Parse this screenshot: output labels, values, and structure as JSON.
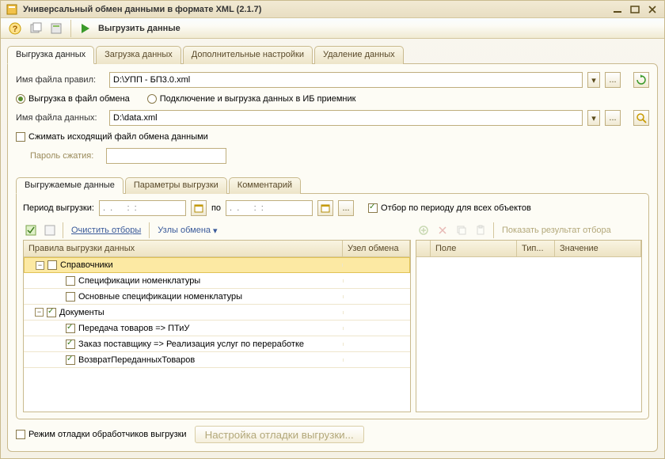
{
  "window": {
    "title": "Универсальный обмен данными в формате XML (2.1.7)"
  },
  "toolbar": {
    "run_label": "Выгрузить данные"
  },
  "tabs": [
    {
      "label": "Выгрузка данных",
      "active": true
    },
    {
      "label": "Загрузка данных",
      "active": false
    },
    {
      "label": "Дополнительные настройки",
      "active": false
    },
    {
      "label": "Удаление данных",
      "active": false
    }
  ],
  "upload": {
    "rules_file_label": "Имя файла правил:",
    "rules_file_value": "D:\\УПП - БП3.0.xml",
    "radio_export_file": "Выгрузка в файл обмена",
    "radio_export_connect": "Подключение и выгрузка данных в ИБ приемник",
    "data_file_label": "Имя файла данных:",
    "data_file_value": "D:\\data.xml",
    "compress_label": "Сжимать исходящий файл обмена данными",
    "compress_pwd_label": "Пароль сжатия:"
  },
  "inner_tabs": [
    {
      "label": "Выгружаемые данные",
      "active": true
    },
    {
      "label": "Параметры выгрузки",
      "active": false
    },
    {
      "label": "Комментарий",
      "active": false
    }
  ],
  "period": {
    "label": "Период выгрузки:",
    "from_placeholder": ".  .      :  :",
    "to_label": "по",
    "to_placeholder": ".  .      :  :",
    "filter_all_label": "Отбор по периоду для всех объектов"
  },
  "gridbar": {
    "clear_filters": "Очистить отборы",
    "nodes": "Узлы обмена",
    "show_result": "Показать результат отбора"
  },
  "left_grid": {
    "col_rules": "Правила выгрузки данных",
    "col_node": "Узел обмена",
    "rows": [
      {
        "level": 0,
        "expander": "-",
        "checked": false,
        "label": "Справочники",
        "selected": true
      },
      {
        "level": 1,
        "expander": "",
        "checked": false,
        "label": "Спецификации номенклатуры"
      },
      {
        "level": 1,
        "expander": "",
        "checked": false,
        "label": "Основные спецификации номенклатуры"
      },
      {
        "level": 0,
        "expander": "-",
        "checked": true,
        "label": "Документы"
      },
      {
        "level": 1,
        "expander": "",
        "checked": true,
        "label": "Передача товаров => ПТиУ"
      },
      {
        "level": 1,
        "expander": "",
        "checked": true,
        "label": "Заказ поставщику => Реализация услуг по переработке"
      },
      {
        "level": 1,
        "expander": "",
        "checked": true,
        "label": "ВозвратПереданныхТоваров"
      }
    ]
  },
  "right_grid": {
    "col_mark": "",
    "col_field": "Поле",
    "col_type": "Тип...",
    "col_value": "Значение"
  },
  "footer": {
    "debug_label": "Режим отладки обработчиков выгрузки",
    "debug_settings_btn": "Настройка отладки выгрузки..."
  },
  "ui": {
    "ellipsis": "...",
    "dropdown_arrow": "▾"
  }
}
